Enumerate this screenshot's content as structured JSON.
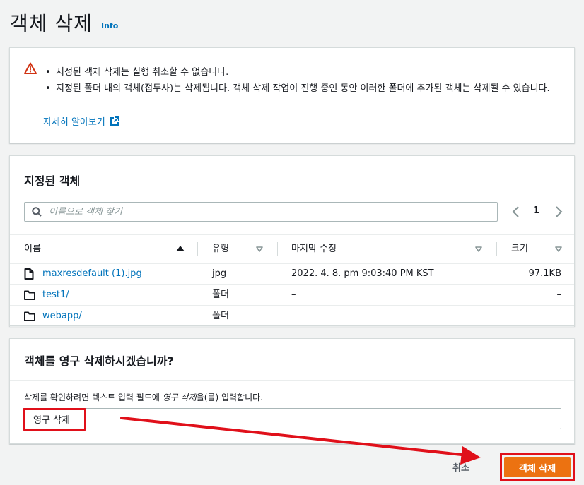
{
  "header": {
    "title": "객체 삭제",
    "info": "Info"
  },
  "warning": {
    "bullets": [
      "지정된 객체 삭제는 실행 취소할 수 없습니다.",
      "지정된 폴더 내의 객체(접두사)는 삭제됩니다. 객체 삭제 작업이 진행 중인 동안 이러한 폴더에 추가된 객체는 삭제될 수 있습니다."
    ],
    "learn_more": "자세히 알아보기",
    "icon": "warning-triangle-icon",
    "color": "#d13212"
  },
  "objects": {
    "title": "지정된 객체",
    "search_placeholder": "이름으로 객체 찾기",
    "page": "1",
    "columns": [
      "이름",
      "유형",
      "마지막 수정",
      "크기"
    ],
    "rows": [
      {
        "name": "maxresdefault (1).jpg",
        "type": "jpg",
        "modified": "2022. 4. 8. pm 9:03:40 PM KST",
        "size": "97.1KB",
        "icon": "file-icon"
      },
      {
        "name": "test1/",
        "type": "폴더",
        "modified": "–",
        "size": "–",
        "icon": "folder-icon"
      },
      {
        "name": "webapp/",
        "type": "폴더",
        "modified": "–",
        "size": "–",
        "icon": "folder-icon"
      }
    ]
  },
  "confirm": {
    "title": "객체를 영구 삭제하시겠습니까?",
    "desc_prefix": "삭제를 확인하려면 텍스트 입력 필드에 ",
    "desc_em": "영구 삭제",
    "desc_suffix": "을(를) 입력합니다.",
    "input_value": "영구 삭제"
  },
  "actions": {
    "cancel": "취소",
    "delete": "객체 삭제",
    "primary_color": "#ec7211",
    "highlight_color": "#e0101a"
  }
}
